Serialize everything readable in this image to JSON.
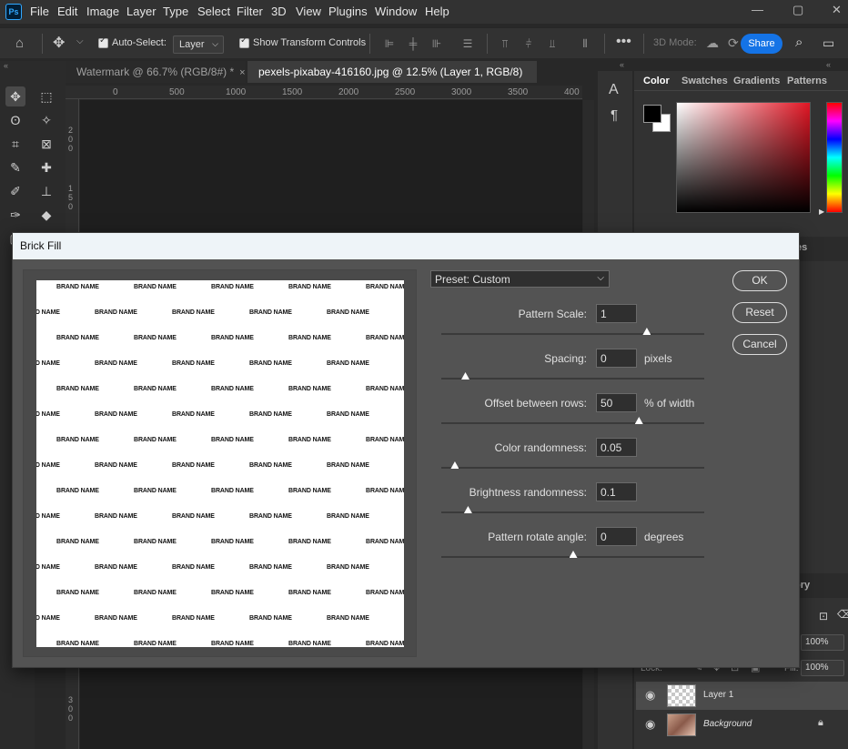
{
  "menubar": {
    "logo": "Ps",
    "items": [
      "File",
      "Edit",
      "Image",
      "Layer",
      "Type",
      "Select",
      "Filter",
      "3D",
      "View",
      "Plugins",
      "Window",
      "Help"
    ]
  },
  "options": {
    "auto_select_label": "Auto-Select:",
    "layer_select": "Layer",
    "transform_label": "Show Transform Controls",
    "mode_3d": "3D Mode:",
    "share": "Share"
  },
  "tabs": [
    {
      "label": "Watermark @ 66.7% (RGB/8#) *",
      "close": "×"
    },
    {
      "label": "pexels-pixabay-416160.jpg @ 12.5% (Layer 1, RGB/8) *",
      "close": "×"
    }
  ],
  "ruler": {
    "h_labels": [
      "0",
      "500",
      "1000",
      "1500",
      "2000",
      "2500",
      "3000",
      "3500",
      "400"
    ],
    "v_labels_top": [
      "2",
      "0",
      "0",
      "1",
      "5",
      "0"
    ],
    "v_labels_bottom": [
      "3",
      "0",
      "0"
    ]
  },
  "panels": {
    "tabs": [
      "Color",
      "Swatches",
      "Gradients",
      "Patterns"
    ],
    "partial_tab_1": "es",
    "partial_tab_2": "ory"
  },
  "layers": {
    "lock_label": "Lock:",
    "fill_label": "Fill:",
    "opacity": "100%",
    "fill": "100%",
    "items": [
      {
        "name": "Layer 1",
        "selected": true
      },
      {
        "name": "Background",
        "selected": false
      }
    ]
  },
  "dialog": {
    "title": "Brick Fill",
    "preset": "Preset: Custom",
    "brand_text": "BRAND NAME",
    "params": [
      {
        "label": "Pattern Scale:",
        "value": "1",
        "unit": "",
        "slider": 0.78
      },
      {
        "label": "Spacing:",
        "value": "0",
        "unit": "pixels",
        "slider": 0.09
      },
      {
        "label": "Offset between rows:",
        "value": "50",
        "unit": "% of width",
        "slider": 0.75
      },
      {
        "label": "Color randomness:",
        "value": "0.05",
        "unit": "",
        "slider": 0.05
      },
      {
        "label": "Brightness randomness:",
        "value": "0.1",
        "unit": "",
        "slider": 0.1
      },
      {
        "label": "Pattern rotate angle:",
        "value": "0",
        "unit": "degrees",
        "slider": 0.5
      }
    ],
    "buttons": {
      "ok": "OK",
      "reset": "Reset",
      "cancel": "Cancel"
    }
  },
  "colors": {
    "accent": "#1473e6",
    "foreground": "#000000",
    "background": "#ffffff"
  }
}
